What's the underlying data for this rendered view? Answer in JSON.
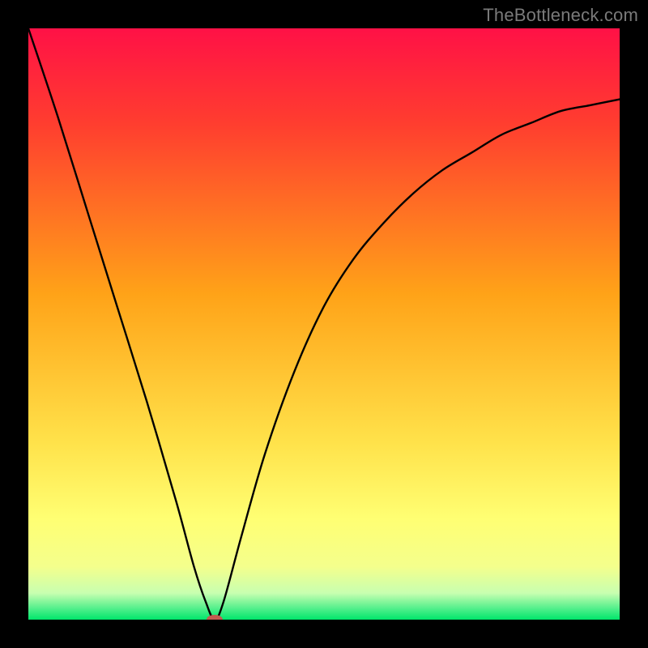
{
  "watermark": "TheBottleneck.com",
  "chart_data": {
    "type": "line",
    "title": "",
    "xlabel": "",
    "ylabel": "",
    "xlim": [
      0,
      100
    ],
    "ylim": [
      0,
      100
    ],
    "grid": false,
    "legend": false,
    "background_gradient": {
      "top_color": "#ff1146",
      "mid_color": "#ffb400",
      "lower_color": "#ffff66",
      "bottom_color": "#00e66b"
    },
    "series": [
      {
        "name": "bottleneck-curve",
        "x": [
          0,
          5,
          10,
          15,
          20,
          25,
          28,
          30,
          31.5,
          33,
          36,
          40,
          45,
          50,
          55,
          60,
          65,
          70,
          75,
          80,
          85,
          90,
          95,
          100
        ],
        "values": [
          100,
          85,
          69,
          53,
          37,
          20,
          9,
          3,
          0,
          3,
          14,
          28,
          42,
          53,
          61,
          67,
          72,
          76,
          79,
          82,
          84,
          86,
          87,
          88
        ]
      }
    ],
    "marker": {
      "name": "min-point",
      "x": 31.5,
      "y": 0,
      "color": "#c45a4f",
      "rx": 10,
      "ry": 6
    }
  }
}
